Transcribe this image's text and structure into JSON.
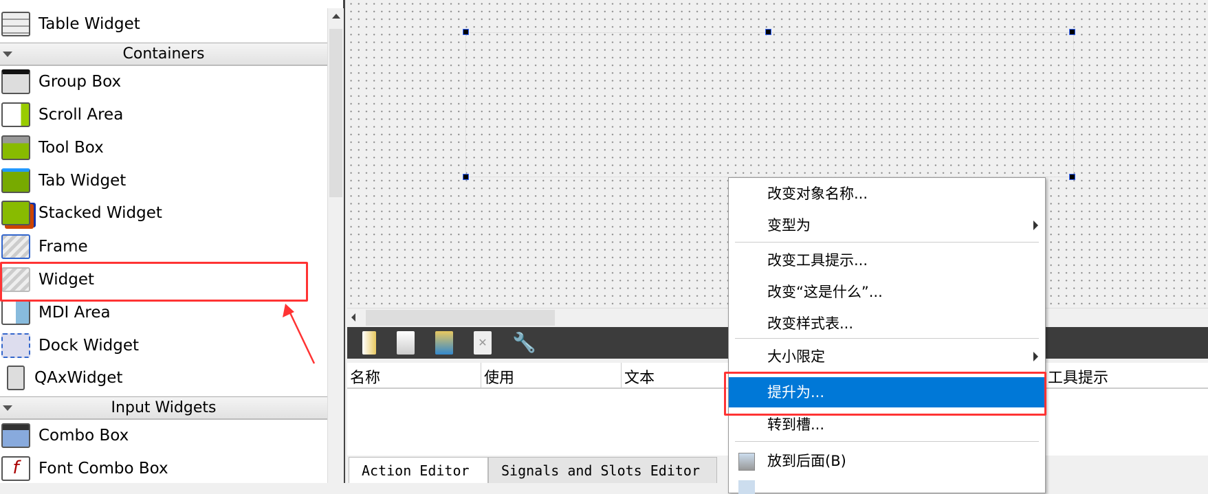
{
  "widget_box": {
    "items_top": [
      {
        "label": "Table Widget",
        "icon": "table-widget-icon"
      }
    ],
    "categories": [
      {
        "label": "Containers",
        "items": [
          {
            "label": "Group Box",
            "icon": "group-box-icon"
          },
          {
            "label": "Scroll Area",
            "icon": "scroll-area-icon"
          },
          {
            "label": "Tool Box",
            "icon": "tool-box-icon"
          },
          {
            "label": "Tab Widget",
            "icon": "tab-widget-icon"
          },
          {
            "label": "Stacked Widget",
            "icon": "stacked-widget-icon"
          },
          {
            "label": "Frame",
            "icon": "frame-icon"
          },
          {
            "label": "Widget",
            "icon": "widget-icon"
          },
          {
            "label": "MDI Area",
            "icon": "mdi-area-icon"
          },
          {
            "label": "Dock Widget",
            "icon": "dock-widget-icon"
          },
          {
            "label": "QAxWidget",
            "icon": "qaxwidget-icon"
          }
        ]
      },
      {
        "label": "Input Widgets",
        "items": [
          {
            "label": "Combo Box",
            "icon": "combo-box-icon"
          },
          {
            "label": "Font Combo Box",
            "icon": "font-combo-box-icon"
          }
        ]
      }
    ]
  },
  "action_editor": {
    "columns": [
      "名称",
      "使用",
      "文本",
      "工具提示"
    ],
    "tabs": [
      "Action Editor",
      "Signals and Slots Editor"
    ]
  },
  "context_menu": {
    "items": [
      "改变对象名称...",
      "变型为",
      "改变工具提示...",
      "改变“这是什么”...",
      "改变样式表...",
      "大小限定",
      "提升为...",
      "转到槽...",
      "放到后面(B)"
    ],
    "highlighted": "提升为..."
  },
  "colors": {
    "highlight": "#0078d7",
    "annotation": "#ff3333"
  }
}
